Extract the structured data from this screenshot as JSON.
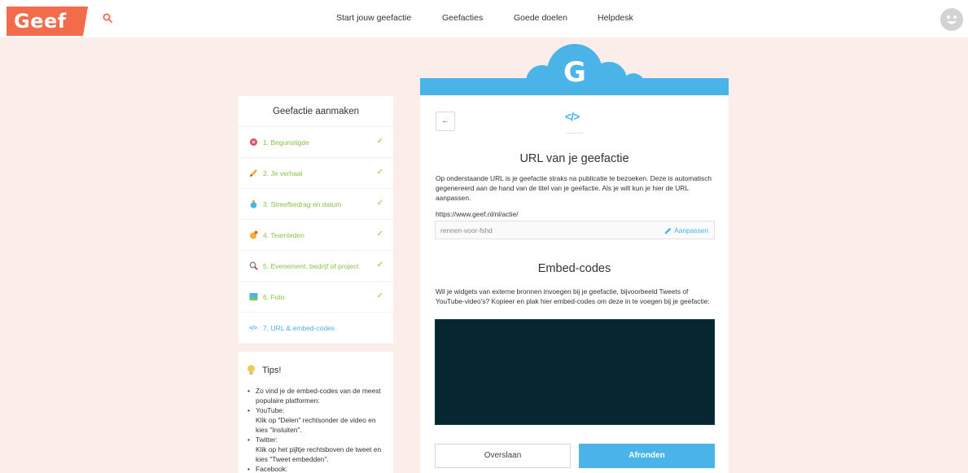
{
  "brand": {
    "logo_text": "Geef",
    "accent": "#f26b4a",
    "primary": "#4ab3e8",
    "success": "#8bc34a"
  },
  "header": {
    "nav": [
      {
        "label": "Start jouw geefactie"
      },
      {
        "label": "Geefacties"
      },
      {
        "label": "Goede doelen"
      },
      {
        "label": "Helpdesk"
      }
    ],
    "search_icon": "search-icon",
    "avatar_icon": "smiley-avatar"
  },
  "sidebar": {
    "title": "Geefactie aanmaken",
    "steps": [
      {
        "label": "1. Begunstigde",
        "icon": "ribbon-icon",
        "done": true
      },
      {
        "label": "2. Je verhaal",
        "icon": "pencil-icon",
        "done": true
      },
      {
        "label": "3. Streefbedrag en datum",
        "icon": "money-bag-icon",
        "done": true
      },
      {
        "label": "4. Teamleden",
        "icon": "team-icon",
        "done": true
      },
      {
        "label": "5. Evenement, bedrijf of project",
        "icon": "magnifier-icon",
        "done": true
      },
      {
        "label": "6. Foto",
        "icon": "photo-icon",
        "done": true
      },
      {
        "label": "7. URL & embed-codes",
        "icon": "code-icon",
        "done": false
      }
    ]
  },
  "tips": {
    "title": "Tips!",
    "items": [
      {
        "text": "Zo vind je de embed-codes van de meest populaire platformen:"
      },
      {
        "text": "YouTube:",
        "detail": "Klik op \"Delen\" rechtsonder de video en kies \"Insluiten\"."
      },
      {
        "text": "Twitter:",
        "detail": "Klik op het pijltje rechtsboven de tweet en kies \"Tweet embedden\"."
      },
      {
        "text": "Facebook:"
      }
    ]
  },
  "main": {
    "banner_letter": "G",
    "back_label": "←",
    "section_icon": "</>",
    "url_section": {
      "title": "URL van je geefactie",
      "description": "Op onderstaande URL is je geefactie straks na publicatie te bezoeken. Deze is automatisch gegenereerd aan de hand van de titel van je geefactie. Als je wilt kun je hier de URL aanpassen.",
      "prefix": "https://www.geef.nl/nl/actie/",
      "slug": "rennen-voor-fshd",
      "edit_label": "Aanpassen"
    },
    "embed_section": {
      "title": "Embed-codes",
      "description": "Wil je widgets van externe bronnen invoegen bij je geefactie, bijvoorbeeld Tweets of YouTube-video's? Kopieer en plak hier embed-codes om deze in te voegen bij je geefactie:",
      "value": ""
    },
    "buttons": {
      "skip": "Overslaan",
      "finish": "Afronden"
    }
  }
}
